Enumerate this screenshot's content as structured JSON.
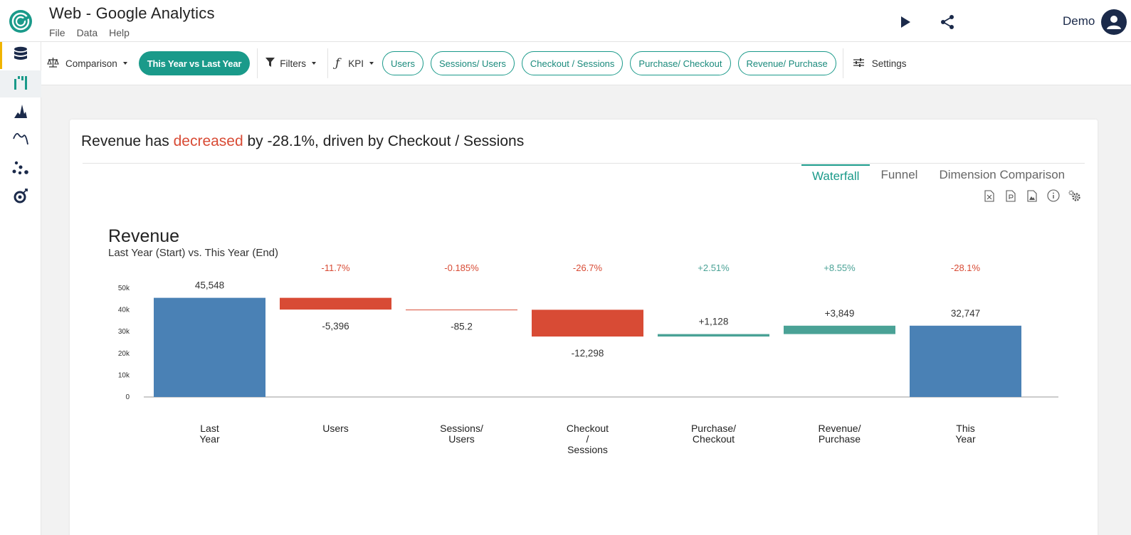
{
  "app": {
    "title": "Web - Google Analytics",
    "menu": [
      "File",
      "Data",
      "Help"
    ],
    "user_name": "Demo"
  },
  "icons": {
    "logo": "logo-icon",
    "play": "play-icon",
    "share": "share-icon",
    "avatar": "user-avatar-icon",
    "sidebar": [
      "database-icon",
      "waterfall-icon",
      "histogram-icon",
      "line-chart-icon",
      "scatter-icon",
      "settings-bug-icon"
    ]
  },
  "toolbar": {
    "comparison_label": "Comparison",
    "comparison_value": "This Year vs Last Year",
    "filters_label": "Filters",
    "kpi_label": "KPI",
    "kpi_pills": [
      "Users",
      "Sessions/ Users",
      "Checkout / Sessions",
      "Purchase/ Checkout",
      "Revenue/ Purchase"
    ],
    "settings_label": "Settings"
  },
  "headline": {
    "prefix": "Revenue has ",
    "highlight": "decreased",
    "suffix": " by -28.1%, driven by Checkout / Sessions"
  },
  "tabs": [
    "Waterfall",
    "Funnel",
    "Dimension Comparison"
  ],
  "active_tab": "Waterfall",
  "action_icons": [
    "excel-export-icon",
    "pdf-export-icon",
    "image-export-icon",
    "info-icon",
    "settings-icon"
  ],
  "colors": {
    "accent": "#1a9a8a",
    "negative": "#d84b35",
    "positive": "#4aa296",
    "total": "#4a81b5"
  },
  "chart_data": {
    "type": "waterfall",
    "title": "Revenue",
    "subtitle": "Last Year (Start) vs. This Year (End)",
    "ylim": [
      0,
      50000
    ],
    "yticks": [
      0,
      10000,
      20000,
      30000,
      40000,
      50000
    ],
    "ytick_labels": [
      "0",
      "10k",
      "20k",
      "30k",
      "40k",
      "50k"
    ],
    "bars": [
      {
        "name": "Last Year",
        "label_lines": [
          "Last",
          "Year"
        ],
        "kind": "total",
        "value": 45548,
        "value_label": "45,548",
        "pct": ""
      },
      {
        "name": "Users",
        "label_lines": [
          "Users"
        ],
        "kind": "delta",
        "value": -5396,
        "value_label": "-5,396",
        "pct": "-11.7%"
      },
      {
        "name": "Sessions/ Users",
        "label_lines": [
          "Sessions/",
          "Users"
        ],
        "kind": "delta",
        "value": -85.2,
        "value_label": "-85.2",
        "pct": "-0.185%"
      },
      {
        "name": "Checkout / Sessions",
        "label_lines": [
          "Checkout",
          "/",
          "Sessions"
        ],
        "kind": "delta",
        "value": -12298,
        "value_label": "-12,298",
        "pct": "-26.7%"
      },
      {
        "name": "Purchase/ Checkout",
        "label_lines": [
          "Purchase/",
          "Checkout"
        ],
        "kind": "delta",
        "value": 1128,
        "value_label": "+1,128",
        "pct": "+2.51%"
      },
      {
        "name": "Revenue/ Purchase",
        "label_lines": [
          "Revenue/",
          "Purchase"
        ],
        "kind": "delta",
        "value": 3849,
        "value_label": "+3,849",
        "pct": "+8.55%"
      },
      {
        "name": "This Year",
        "label_lines": [
          "This",
          "Year"
        ],
        "kind": "total",
        "value": 32747,
        "value_label": "32,747",
        "pct": "-28.1%"
      }
    ]
  }
}
